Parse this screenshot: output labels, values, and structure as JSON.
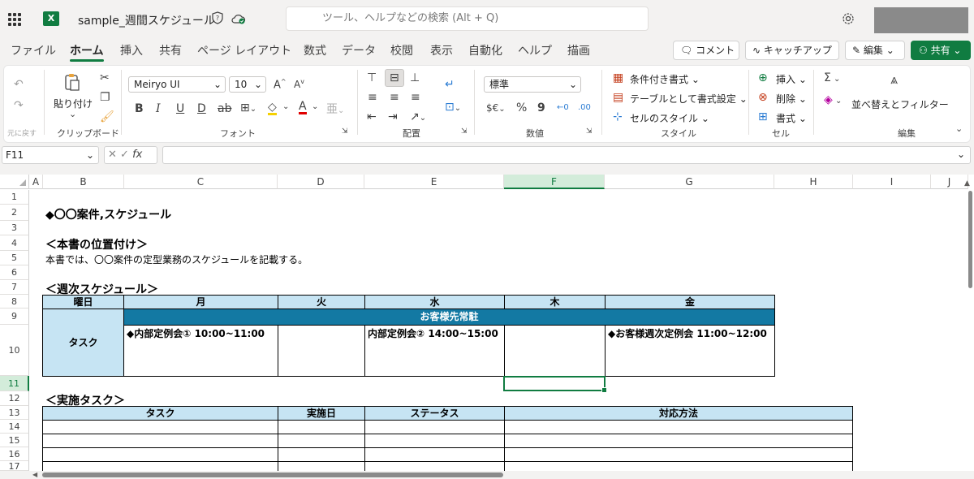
{
  "window": {
    "file_name": "sample_週間スケジュール",
    "search_placeholder": "ツール、ヘルプなどの検索 (Alt + Q)"
  },
  "tabs": [
    "ファイル",
    "ホーム",
    "挿入",
    "共有",
    "ページ レイアウト",
    "数式",
    "データ",
    "校閲",
    "表示",
    "自動化",
    "ヘルプ",
    "描画"
  ],
  "active_tab": "ホーム",
  "actions": {
    "comment": "コメント",
    "catchup": "キャッチアップ",
    "edit": "編集",
    "share": "共有"
  },
  "ribbon": {
    "undo_label": "元に戻す",
    "paste_label": "貼り付け",
    "clipboard_group": "クリップボード",
    "font_name": "Meiryo UI",
    "font_size": "10",
    "font_group": "フォント",
    "align_group": "配置",
    "number_format": "標準",
    "number_group": "数値",
    "cond_format": "条件付き書式",
    "table_format": "テーブルとして書式設定",
    "cell_style": "セルのスタイル",
    "style_group": "スタイル",
    "insert": "挿入",
    "delete": "削除",
    "format": "書式",
    "cells_group": "セル",
    "sort_filter": "並べ替えとフィルター",
    "edit_group": "編集"
  },
  "formula_bar": {
    "name_box": "F11",
    "value": ""
  },
  "columns": [
    "A",
    "B",
    "C",
    "D",
    "E",
    "F",
    "G",
    "H",
    "I",
    "J"
  ],
  "rows": [
    "1",
    "2",
    "3",
    "4",
    "5",
    "6",
    "7",
    "8",
    "9",
    "10",
    "11",
    "12",
    "13",
    "14",
    "15",
    "16",
    "17"
  ],
  "selected_cell": "F11",
  "sheet": {
    "title": "◆〇〇案件,スケジュール",
    "section_position": "＜本書の位置付け＞",
    "description": "本書では、〇〇案件の定型業務のスケジュールを記載する。",
    "section_weekly": "＜週次スケジュール＞",
    "weekly_headers": [
      "曜日",
      "月",
      "火",
      "水",
      "木",
      "金"
    ],
    "client_resident": "お客様先常駐",
    "task_label": "タスク",
    "tasks": {
      "mon": "◆内部定例会①  10:00~11:00",
      "tue": "",
      "wed": "内部定例会②  14:00~15:00",
      "thu": "",
      "fri": "◆お客様週次定例会  11:00~12:00"
    },
    "section_tasks": "＜実施タスク＞",
    "task_headers": [
      "タスク",
      "実施日",
      "ステータス",
      "対応方法"
    ]
  },
  "colors": {
    "excel_green": "#107c41",
    "header_fill": "#c6e4f3",
    "resident_fill": "#1379a3"
  }
}
